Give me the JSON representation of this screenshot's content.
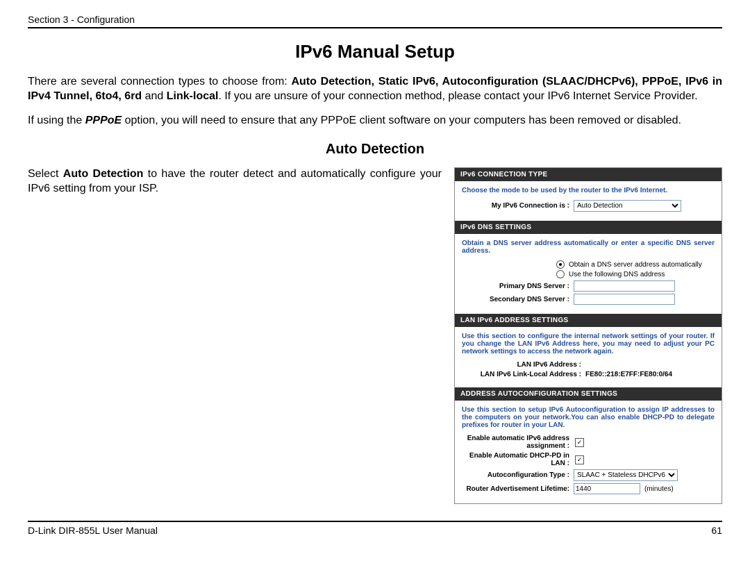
{
  "header": {
    "section": "Section 3 - Configuration"
  },
  "title": "IPv6 Manual Setup",
  "intro": {
    "lead": "There are several connection types to choose from: ",
    "list": "Auto Detection, Static IPv6, Autoconfiguration (SLAAC/DHCPv6), PPPoE, IPv6 in IPv4 Tunnel, 6to4, 6rd",
    "and": " and ",
    "last": "Link-local",
    "tail": ". If you are unsure of your connection method, please contact your IPv6 Internet Service Provider."
  },
  "pppoe": {
    "lead": "If using the ",
    "term": "PPPoE",
    "tail": " option, you will need to ensure that any PPPoE client software on your computers has been removed or disabled."
  },
  "subTitle": "Auto Detection",
  "autoText": {
    "lead": "Select ",
    "term": "Auto Detection",
    "tail": " to have the router detect and automatically configure your IPv6 setting from your ISP."
  },
  "panel": {
    "conn": {
      "header": "IPv6 CONNECTION TYPE",
      "instr": "Choose the mode to be used by the router to the IPv6 Internet.",
      "label": "My IPv6 Connection is :",
      "value": "Auto Detection"
    },
    "dns": {
      "header": "IPv6 DNS SETTINGS",
      "instr": "Obtain a DNS server address automatically or enter a specific DNS server address.",
      "opt1": "Obtain a DNS server address automatically",
      "opt2": "Use the following DNS address",
      "primary": "Primary DNS Server :",
      "secondary": "Secondary DNS Server :"
    },
    "lan": {
      "header": "LAN IPv6 ADDRESS SETTINGS",
      "instr": "Use this section to configure the internal network settings of your router. If you change the LAN IPv6 Address here, you may need to adjust your PC network settings to access the network again.",
      "addrLabel": "LAN IPv6 Address :",
      "linkLabel": "LAN IPv6 Link-Local Address :",
      "linkValue": "FE80::218:E7FF:FE80:0/64"
    },
    "auto": {
      "header": "ADDRESS AUTOCONFIGURATION SETTINGS",
      "instr": "Use this section to setup IPv6 Autoconfiguration to assign IP addresses to the computers on your network.You can also enable DHCP-PD to delegate prefixes for router in your LAN.",
      "enableAuto": "Enable automatic IPv6 address assignment :",
      "enablePD": "Enable Automatic DHCP-PD in LAN :",
      "typeLabel": "Autoconfiguration Type :",
      "typeValue": "SLAAC + Stateless DHCPv6",
      "raLabel": "Router Advertisement Lifetime:",
      "raValue": "1440",
      "raUnit": "(minutes)"
    }
  },
  "footer": {
    "left": "D-Link DIR-855L User Manual",
    "right": "61"
  }
}
